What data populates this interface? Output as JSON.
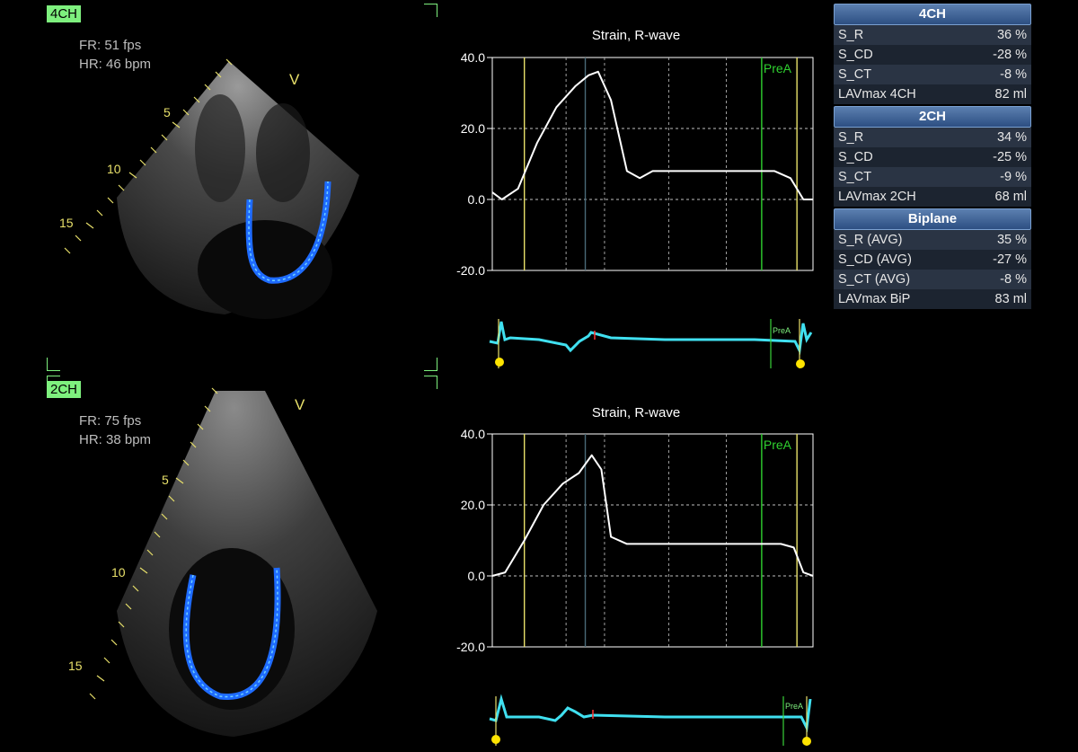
{
  "views": [
    {
      "tag": "4CH",
      "fr": "FR: 51 fps",
      "hr": "HR: 46 bpm",
      "marker": "V",
      "depths": [
        "5",
        "10",
        "15"
      ]
    },
    {
      "tag": "2CH",
      "fr": "FR: 75 fps",
      "hr": "HR: 38 bpm",
      "marker": "V",
      "depths": [
        "5",
        "10",
        "15"
      ]
    }
  ],
  "charts_text": [
    {
      "title": "Strain, R-wave",
      "ticks": [
        "40.0",
        "20.0",
        "0.0",
        "-20.0"
      ],
      "event": "PreA",
      "ecg_event": "PreA"
    },
    {
      "title": "Strain, R-wave",
      "ticks": [
        "40.0",
        "20.0",
        "0.0",
        "-20.0"
      ],
      "event": "PreA",
      "ecg_event": "PreA"
    }
  ],
  "chart_data": [
    {
      "type": "line",
      "title": "Strain, R-wave",
      "xlabel": "",
      "ylabel": "",
      "ylim": [
        -20,
        40
      ],
      "yticks": [
        40.0,
        20.0,
        0.0,
        -20.0
      ],
      "grid": true,
      "x": [
        0,
        0.03,
        0.08,
        0.14,
        0.2,
        0.26,
        0.3,
        0.33,
        0.37,
        0.42,
        0.46,
        0.5,
        0.6,
        0.7,
        0.8,
        0.88,
        0.93,
        0.97,
        1.0
      ],
      "series": [
        {
          "values": [
            2,
            0,
            3,
            16,
            26,
            32,
            35,
            36,
            28,
            8,
            6,
            8,
            8,
            8,
            8,
            8,
            6,
            0,
            0
          ]
        }
      ],
      "color": "#ffffff"
    },
    {
      "type": "line",
      "title": "Strain, R-wave",
      "xlabel": "",
      "ylabel": "",
      "ylim": [
        -20,
        40
      ],
      "yticks": [
        40.0,
        20.0,
        0.0,
        -20.0
      ],
      "grid": true,
      "x": [
        0,
        0.04,
        0.1,
        0.16,
        0.22,
        0.27,
        0.31,
        0.34,
        0.37,
        0.42,
        0.5,
        0.6,
        0.7,
        0.8,
        0.9,
        0.94,
        0.97,
        1.0
      ],
      "series": [
        {
          "values": [
            0,
            1,
            10,
            20,
            26,
            29,
            34,
            30,
            11,
            9,
            9,
            9,
            9,
            9,
            9,
            8,
            1,
            0
          ]
        }
      ],
      "color": "#ffffff"
    }
  ],
  "table": [
    {
      "header": "4CH",
      "rows": [
        [
          "S_R",
          "36 %"
        ],
        [
          "S_CD",
          "-28 %"
        ],
        [
          "S_CT",
          "-8 %"
        ],
        [
          "LAVmax 4CH",
          "82 ml"
        ]
      ]
    },
    {
      "header": "2CH",
      "rows": [
        [
          "S_R",
          "34 %"
        ],
        [
          "S_CD",
          "-25 %"
        ],
        [
          "S_CT",
          "-9 %"
        ],
        [
          "LAVmax 2CH",
          "68 ml"
        ]
      ]
    },
    {
      "header": "Biplane",
      "rows": [
        [
          "S_R (AVG)",
          "35 %"
        ],
        [
          "S_CD (AVG)",
          "-27 %"
        ],
        [
          "S_CT (AVG)",
          "-8 %"
        ],
        [
          "LAVmax BiP",
          "83 ml"
        ]
      ]
    }
  ],
  "colors": {
    "accent": "#7ef07e",
    "marker": "#e8e06a",
    "ecg": "#40e0f0",
    "tracking": "#1e6bff"
  }
}
